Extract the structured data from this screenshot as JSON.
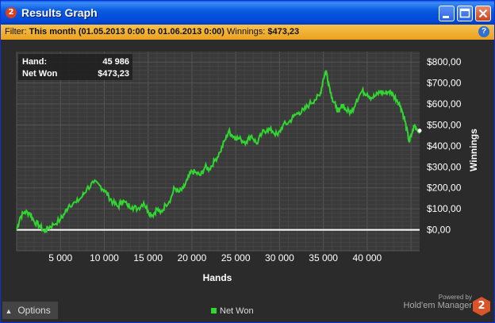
{
  "window": {
    "app_icon_text": "2",
    "title": "Results Graph",
    "buttons": [
      "minimize-icon",
      "maximize-icon",
      "close-icon"
    ]
  },
  "filter": {
    "label": "Filter:",
    "range": "This month (01.05.2013 0:00 to 01.06.2013 0:00)",
    "winnings_label": "Winnings:",
    "winnings_value": "$473,23",
    "help_icon": "help-icon"
  },
  "tooltip": {
    "hand_label": "Hand:",
    "hand_value": "45 986",
    "net_label": "Net Won",
    "net_value": "$473,23"
  },
  "bottom": {
    "options_label": "Options",
    "powered_by": "Powered by",
    "brand": "Hold'em Manager",
    "brand_logo": "2"
  },
  "colors": {
    "series": "#31d631",
    "zero_line": "#ffffff",
    "plot_bg": "#3a3a3a",
    "accent_filter": "#f2b33a"
  },
  "chart_data": {
    "type": "line",
    "xlabel": "Hands",
    "ylabel": "Winnings",
    "xlim": [
      0,
      45986
    ],
    "ylim": [
      -100,
      850
    ],
    "x_ticks": [
      5000,
      10000,
      15000,
      20000,
      25000,
      30000,
      35000,
      40000
    ],
    "x_tick_labels": [
      "5 000",
      "10 000",
      "15 000",
      "20 000",
      "25 000",
      "30 000",
      "35 000",
      "40 000"
    ],
    "y_ticks": [
      0,
      100,
      200,
      300,
      400,
      500,
      600,
      700,
      800
    ],
    "y_tick_labels": [
      "$0,00",
      "$100,00",
      "$200,00",
      "$300,00",
      "$400,00",
      "$500,00",
      "$600,00",
      "$700,00",
      "$800,00"
    ],
    "legend": "bottom-center",
    "grid": true,
    "series": [
      {
        "name": "Net Won",
        "x": [
          0,
          400,
          900,
          1500,
          2000,
          2600,
          3200,
          3600,
          4200,
          5000,
          5500,
          6000,
          6800,
          7500,
          8000,
          8800,
          9500,
          10000,
          10500,
          11000,
          11600,
          12000,
          12600,
          13200,
          13800,
          14500,
          15000,
          15500,
          16000,
          16400,
          17000,
          17600,
          18000,
          18500,
          19000,
          19500,
          20000,
          20500,
          21000,
          21500,
          22000,
          22600,
          23200,
          23800,
          24200,
          24600,
          25000,
          25600,
          26200,
          26800,
          27400,
          28000,
          28600,
          29200,
          29800,
          30400,
          31000,
          31600,
          32200,
          32800,
          33400,
          34000,
          34600,
          35000,
          35300,
          35600,
          36000,
          36400,
          36800,
          37200,
          37600,
          38200,
          38800,
          39400,
          40000,
          40500,
          41000,
          41500,
          42000,
          42500,
          43000,
          43400,
          43800,
          44200,
          44500,
          44800,
          45100,
          45400,
          45700,
          45986
        ],
        "y": [
          0,
          60,
          85,
          80,
          40,
          20,
          -10,
          10,
          25,
          50,
          80,
          120,
          130,
          160,
          195,
          225,
          210,
          190,
          160,
          130,
          110,
          140,
          120,
          110,
          100,
          130,
          90,
          70,
          100,
          80,
          120,
          150,
          200,
          180,
          195,
          240,
          280,
          270,
          260,
          300,
          290,
          330,
          370,
          430,
          470,
          450,
          440,
          430,
          420,
          450,
          410,
          460,
          480,
          470,
          450,
          500,
          510,
          540,
          560,
          570,
          600,
          620,
          640,
          720,
          760,
          700,
          630,
          590,
          560,
          600,
          570,
          560,
          620,
          660,
          650,
          630,
          640,
          660,
          650,
          660,
          640,
          620,
          590,
          540,
          480,
          420,
          460,
          500,
          480,
          473
        ]
      }
    ]
  }
}
